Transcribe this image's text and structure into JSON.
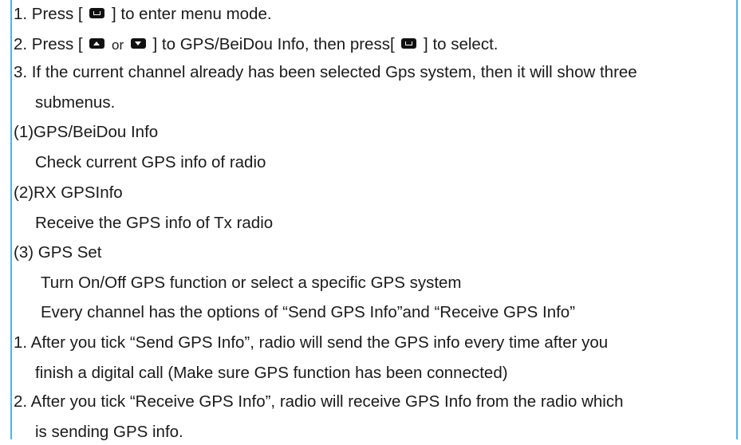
{
  "steps": {
    "step1": {
      "before": "1. Press [",
      "after": "] to enter menu mode."
    },
    "step2": {
      "before": "2. Press [",
      "or": "or",
      "middle": "] to GPS/BeiDou Info, then press[",
      "after": "]  to select."
    },
    "step3": {
      "line1": "3. If the current channel already has been selected Gps system, then it will show three",
      "line2": "submenus."
    }
  },
  "submenus": [
    {
      "title": "(1)GPS/BeiDou Info",
      "desc": "Check current GPS info of radio"
    },
    {
      "title": "(2)RX GPSInfo",
      "desc": "Receive the GPS info of Tx radio"
    },
    {
      "title": "(3) GPS Set",
      "desc": "Turn On/Off GPS function or select a specific GPS system",
      "desc2": "Every channel has the options of “Send GPS Info”and “Receive GPS Info”"
    }
  ],
  "notes": [
    {
      "line1": "1. After you tick “Send GPS Info”, radio will send the GPS info every time after you",
      "line2": "finish a digital call (Make sure GPS function has been connected)"
    },
    {
      "line1": "2. After you tick “Receive GPS Info”, radio will receive GPS Info from the radio which",
      "line2": "is sending GPS info."
    }
  ],
  "icons": {
    "menu_key": "menu-key-icon",
    "up_key": "up-key-icon",
    "down_key": "down-key-icon"
  },
  "colors": {
    "border": "#4fb3e8",
    "text": "#1a1a1a",
    "key": "#111111"
  }
}
